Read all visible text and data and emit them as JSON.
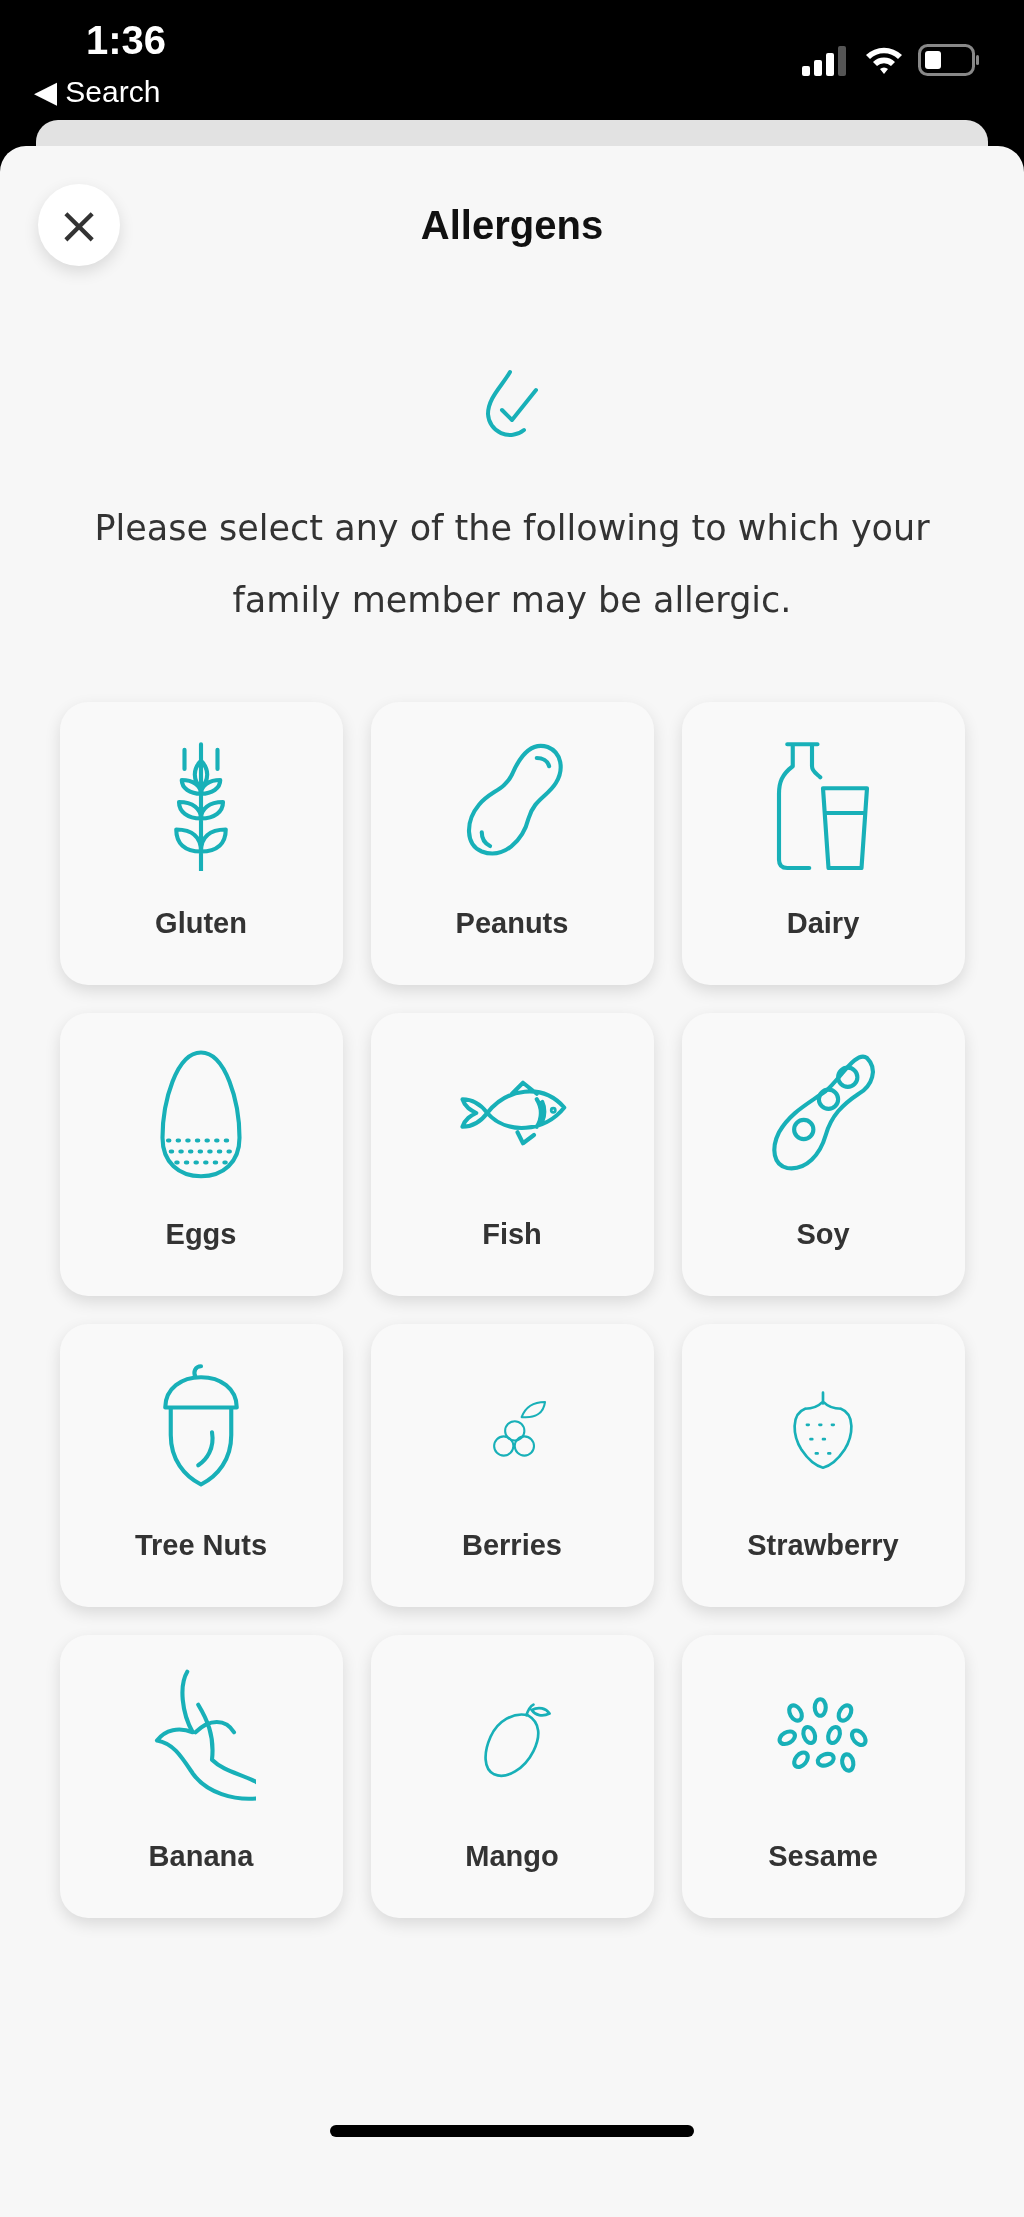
{
  "status_bar": {
    "time": "1:36",
    "back_link": "◀ Search"
  },
  "header": {
    "title": "Allergens",
    "close": "×"
  },
  "intro": "Please select any of the following to which your family member may be allergic.",
  "allergens": [
    {
      "label": "Gluten",
      "selected": false
    },
    {
      "label": "Peanuts",
      "selected": false
    },
    {
      "label": "Dairy",
      "selected": false
    },
    {
      "label": "Eggs",
      "selected": false
    },
    {
      "label": "Fish",
      "selected": false
    },
    {
      "label": "Soy",
      "selected": false
    },
    {
      "label": "Tree Nuts",
      "selected": false
    },
    {
      "label": "Berries",
      "selected": false
    },
    {
      "label": "Strawberry",
      "selected": false
    },
    {
      "label": "Banana",
      "selected": false
    },
    {
      "label": "Mango",
      "selected": false
    },
    {
      "label": "Sesame",
      "selected": false
    }
  ]
}
